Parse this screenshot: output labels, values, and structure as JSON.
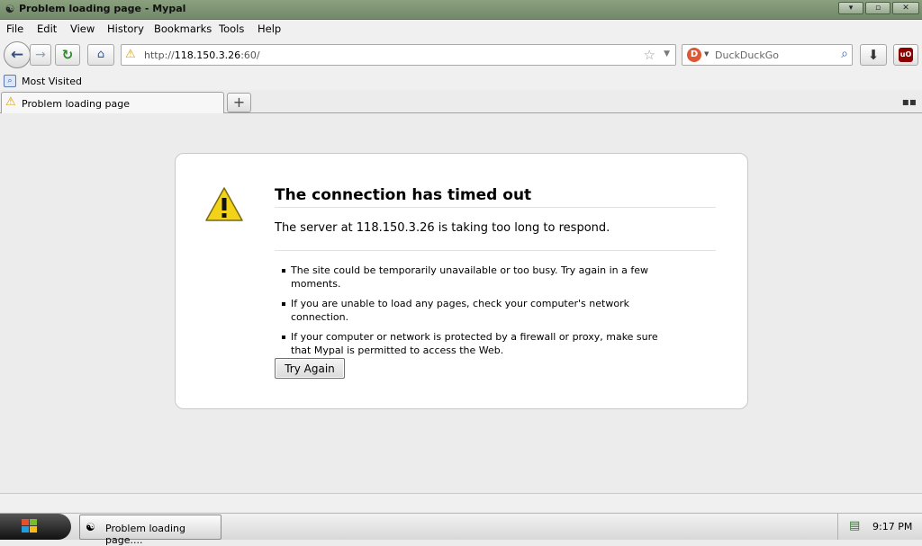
{
  "window": {
    "title": "Problem loading page - Mypal",
    "controls": {
      "minimize": "▾",
      "restore": "▫",
      "close": "✕"
    }
  },
  "menu": [
    "File",
    "Edit",
    "View",
    "History",
    "Bookmarks",
    "Tools",
    "Help"
  ],
  "navbar": {
    "url_prefix": "http://",
    "url_host": "118.150.3.26",
    "url_suffix": ":60/",
    "search_placeholder": "DuckDuckGo"
  },
  "bookmarks": {
    "label": "Most Visited"
  },
  "tabs": [
    {
      "label": "Problem loading page",
      "active": true
    }
  ],
  "error": {
    "title": "The connection has timed out",
    "description": "The server at 118.150.3.26 is taking too long to respond.",
    "bullets": [
      "The site could be temporarily unavailable or too busy. Try again in a few moments.",
      "If you are unable to load any pages, check your computer's network connection.",
      "If your computer or network is protected by a firewall or proxy, make sure that Mypal is permitted to access the Web."
    ],
    "button_label": "Try Again"
  },
  "taskbar": {
    "task_label": "Problem loading page....",
    "clock": "9:17 PM"
  },
  "icons": {
    "warning": "⚠",
    "back": "←",
    "forward": "→",
    "reload": "↻",
    "home": "⌂",
    "star": "☆",
    "dropdown": "▼",
    "search": "⌕",
    "download": "⬇",
    "new_tab": "+",
    "tab_grid": "▪▪",
    "network": "▤",
    "ublock": "uO",
    "duckduckgo": "D",
    "bookmark": "⌕",
    "app": "☯"
  },
  "colors": {
    "titlebar": "#7d9474",
    "error_box_bg": "#ffffff",
    "warning_yellow": "#f3d21a"
  }
}
